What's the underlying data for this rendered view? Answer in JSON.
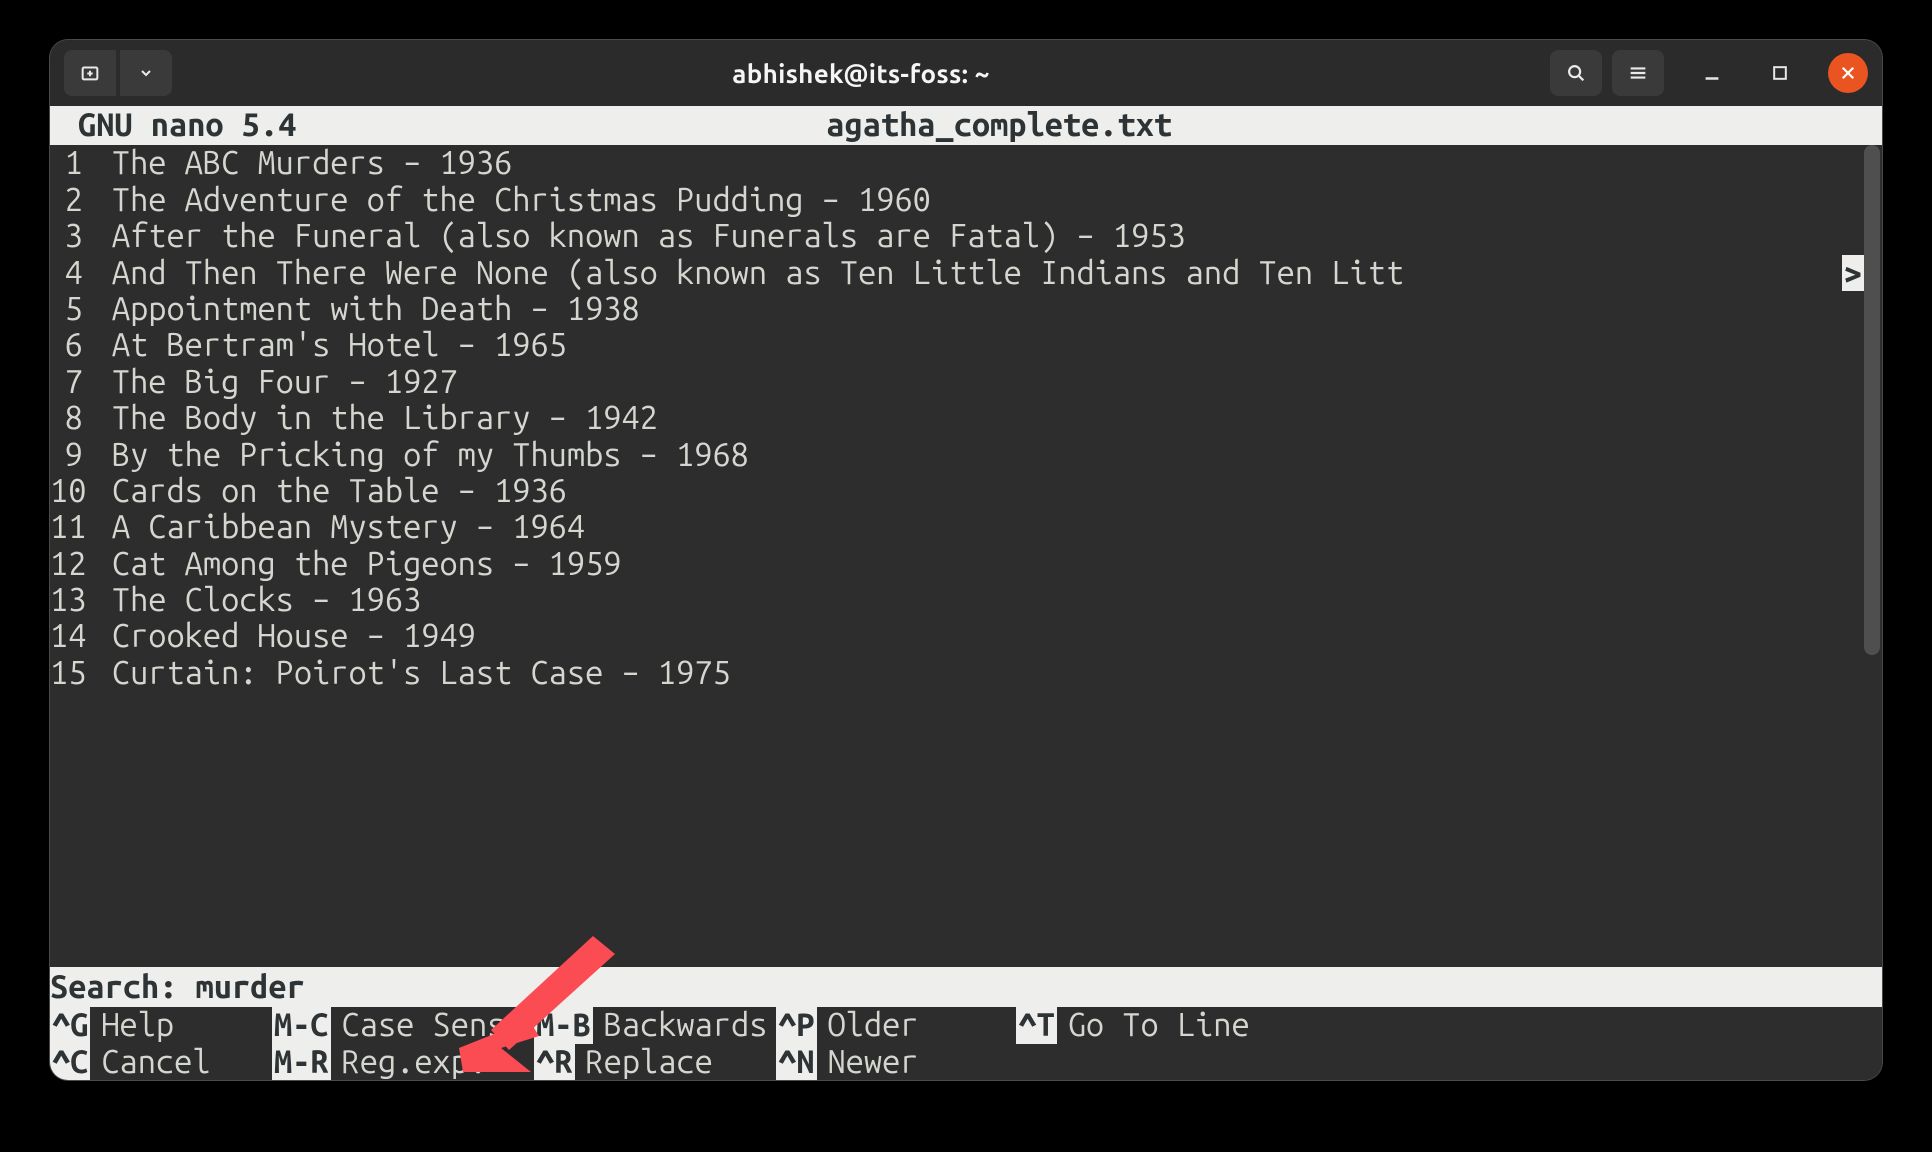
{
  "titlebar": {
    "title": "abhishek@its-foss: ~"
  },
  "nano": {
    "version": "GNU nano 5.4",
    "filename": "agatha_complete.txt",
    "search_label": "Search: ",
    "search_value": "murder",
    "truncate_glyph": ">"
  },
  "lines": [
    {
      "n": "1",
      "text": "The ABC Murders – 1936"
    },
    {
      "n": "2",
      "text": "The Adventure of the Christmas Pudding – 1960"
    },
    {
      "n": "3",
      "text": "After the Funeral (also known as Funerals are Fatal) – 1953"
    },
    {
      "n": "4",
      "text": "And Then There Were None (also known as Ten Little Indians and Ten Litt",
      "truncated": true
    },
    {
      "n": "5",
      "text": "Appointment with Death – 1938"
    },
    {
      "n": "6",
      "text": "At Bertram's Hotel – 1965"
    },
    {
      "n": "7",
      "text": "The Big Four – 1927"
    },
    {
      "n": "8",
      "text": "The Body in the Library – 1942"
    },
    {
      "n": "9",
      "text": "By the Pricking of my Thumbs – 1968"
    },
    {
      "n": "10",
      "text": "Cards on the Table – 1936"
    },
    {
      "n": "11",
      "text": "A Caribbean Mystery – 1964"
    },
    {
      "n": "12",
      "text": "Cat Among the Pigeons – 1959"
    },
    {
      "n": "13",
      "text": "The Clocks – 1963"
    },
    {
      "n": "14",
      "text": "Crooked House – 1949"
    },
    {
      "n": "15",
      "text": "Curtain: Poirot's Last Case – 1975"
    }
  ],
  "shortcuts": {
    "row1": [
      {
        "key": "^G",
        "label": "Help"
      },
      {
        "key": "M-C",
        "label": "Case Sens"
      },
      {
        "key": "M-B",
        "label": "Backwards"
      },
      {
        "key": "^P",
        "label": "Older"
      },
      {
        "key": "^T",
        "label": "Go To Line"
      }
    ],
    "row2": [
      {
        "key": "^C",
        "label": "Cancel"
      },
      {
        "key": "M-R",
        "label": "Reg.exp."
      },
      {
        "key": "^R",
        "label": "Replace"
      },
      {
        "key": "^N",
        "label": "Newer"
      }
    ]
  },
  "colors": {
    "accent": "#e95420",
    "ui_bg": "#2d2d2d",
    "inverse_bg": "#eeeeec",
    "inverse_fg": "#2e3436",
    "text": "#d3d7cf",
    "arrow": "#fb4b53"
  }
}
